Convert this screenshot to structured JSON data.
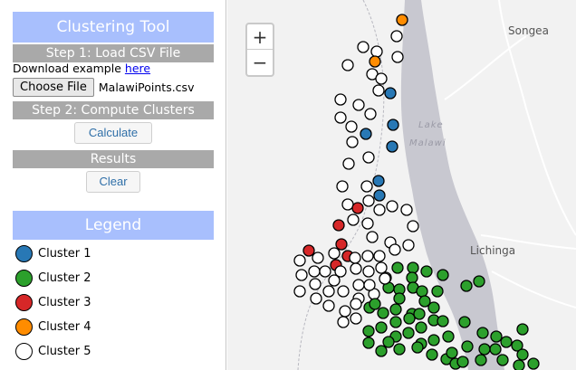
{
  "sidebar": {
    "title": "Clustering Tool",
    "step1": "Step 1: Load CSV File",
    "download_text": "Download example ",
    "download_link": "here",
    "choose_file_label": "Choose File",
    "file_name": "MalawiPoints.csv",
    "step2": "Step 2: Compute Clusters",
    "calculate_label": "Calculate",
    "results_title": "Results",
    "clear_label": "Clear"
  },
  "legend": {
    "title": "Legend",
    "items": [
      {
        "label": "Cluster 1",
        "color": "#2878b5"
      },
      {
        "label": "Cluster 2",
        "color": "#2ca02c"
      },
      {
        "label": "Cluster 3",
        "color": "#d62728"
      },
      {
        "label": "Cluster 4",
        "color": "#ff8c00"
      },
      {
        "label": "Cluster 5",
        "color": "#ffffff"
      }
    ]
  },
  "map": {
    "zoom_in": "+",
    "zoom_out": "−",
    "places": {
      "songea": "Songea",
      "lichinga": "Lichinga",
      "lake_line1": "Lake",
      "lake_line2": "Malawi"
    },
    "colors": {
      "land": "#f2f2f2",
      "lake": "#c8c8d0",
      "road": "#ffffff",
      "border": "#b8b8c0"
    }
  }
}
